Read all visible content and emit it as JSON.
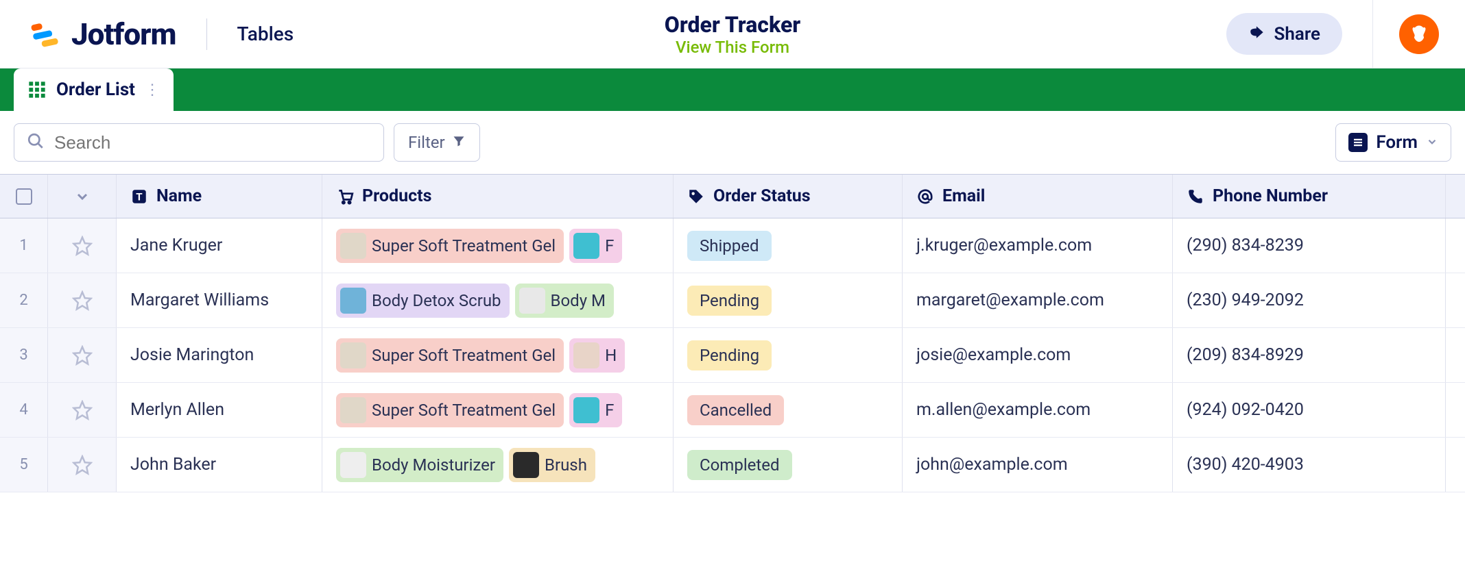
{
  "brand": {
    "name": "Jotform",
    "section": "Tables"
  },
  "header": {
    "title": "Order Tracker",
    "view_link": "View This Form",
    "share": "Share"
  },
  "tab": {
    "label": "Order List"
  },
  "toolbar": {
    "search_placeholder": "Search",
    "filter": "Filter",
    "form_button": "Form"
  },
  "columns": {
    "name": "Name",
    "products": "Products",
    "status": "Order Status",
    "email": "Email",
    "phone": "Phone Number"
  },
  "status_colors": {
    "Shipped": "#cfe9f7",
    "Pending": "#fcebb6",
    "Cancelled": "#f8cfc9",
    "Completed": "#cfeccb"
  },
  "product_colors": {
    "Super Soft Treatment Gel": "#f8cfc9",
    "Body Detox Scrub": "#e2d6f5",
    "Body Moisturizer": "#d3edc8",
    "Brush": "#f6e3bb",
    "F": "#f5cfe8",
    "H": "#f5cfe8",
    "Body M": "#d3edc8"
  },
  "rows": [
    {
      "idx": "1",
      "name": "Jane Kruger",
      "products": [
        {
          "label": "Super Soft Treatment Gel",
          "thumb": "#e0d7c8"
        },
        {
          "label": "F",
          "thumb": "#3fbfd1"
        }
      ],
      "status": "Shipped",
      "email": "j.kruger@example.com",
      "phone": "(290) 834-8239"
    },
    {
      "idx": "2",
      "name": "Margaret Williams",
      "products": [
        {
          "label": "Body Detox Scrub",
          "thumb": "#6fb3d9"
        },
        {
          "label": "Body M",
          "thumb": "#e8e8e8"
        }
      ],
      "status": "Pending",
      "email": "margaret@example.com",
      "phone": "(230) 949-2092"
    },
    {
      "idx": "3",
      "name": "Josie Marington",
      "products": [
        {
          "label": "Super Soft Treatment Gel",
          "thumb": "#e0d7c8"
        },
        {
          "label": "H",
          "thumb": "#e8d4c8"
        }
      ],
      "status": "Pending",
      "email": "josie@example.com",
      "phone": "(209) 834-8929"
    },
    {
      "idx": "4",
      "name": "Merlyn Allen",
      "products": [
        {
          "label": "Super Soft Treatment Gel",
          "thumb": "#e0d7c8"
        },
        {
          "label": "F",
          "thumb": "#3fbfd1"
        }
      ],
      "status": "Cancelled",
      "email": "m.allen@example.com",
      "phone": "(924) 092-0420"
    },
    {
      "idx": "5",
      "name": "John Baker",
      "products": [
        {
          "label": "Body Moisturizer",
          "thumb": "#eeeeee"
        },
        {
          "label": "Brush",
          "thumb": "#2a2a2a"
        }
      ],
      "status": "Completed",
      "email": "john@example.com",
      "phone": "(390) 420-4903"
    }
  ]
}
